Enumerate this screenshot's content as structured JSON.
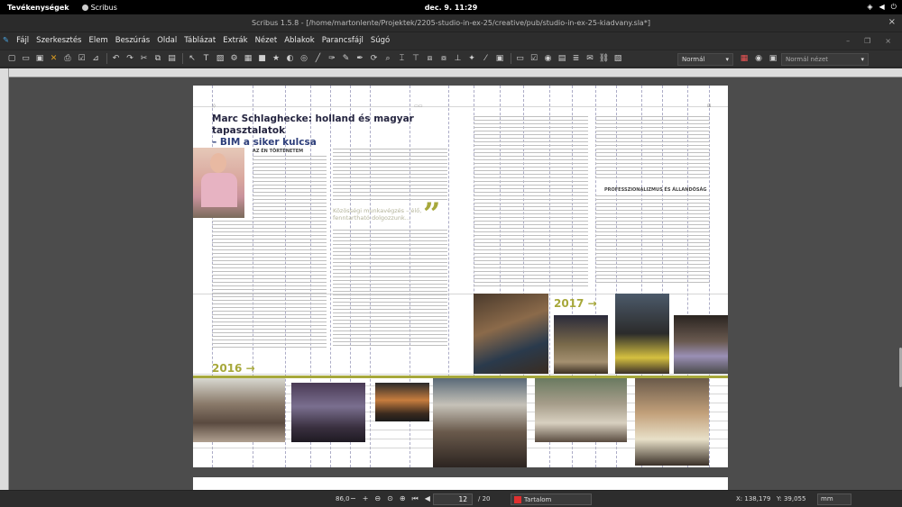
{
  "system": {
    "activities": "Tevékenységek",
    "app_name": "Scribus",
    "clock": "dec. 9.  11:29",
    "tray_icons": [
      "network-icon",
      "volume-icon",
      "power-icon"
    ]
  },
  "window": {
    "title": "Scribus 1.5.8 - [/home/martonlente/Projektek/2205-studio-in-ex-25/creative/pub/studio-in-ex-25-kiadvany.sla*]",
    "close": "×"
  },
  "menu": [
    "Fájl",
    "Szerkesztés",
    "Elem",
    "Beszúrás",
    "Oldal",
    "Táblázat",
    "Extrák",
    "Nézet",
    "Ablakok",
    "Parancsfájl",
    "Súgó"
  ],
  "toolbar": {
    "mode_combo": "Normál",
    "view_combo": "Normál nézet"
  },
  "document": {
    "headline_line1": "Marc Schlaghecke: holland és magyar tapasztalatok",
    "headline_line2": "– BIM a siker kulcsa",
    "section_caption1": "AZ ÉN TÖRTÉNETEM",
    "section_caption2": "PROFESSZIONALIZMUS ÉS ÁLLANDÓSÁG",
    "pull_quote": "Közösségi munkavégzés – élő, fenntartható dolgozzunk...",
    "quote_mark": "”",
    "year_a": "2016 →",
    "year_b": "2017 →",
    "colors": {
      "accent": "#a7a83b",
      "headline": "#252540",
      "subheadline": "#2d3e7a"
    }
  },
  "status": {
    "zoom": "86,0",
    "current_page": "12",
    "page_total": "/ 20",
    "layer": "Tartalom",
    "x": "X: 138,179",
    "y": "Y: 39,055",
    "unit": "mm"
  }
}
